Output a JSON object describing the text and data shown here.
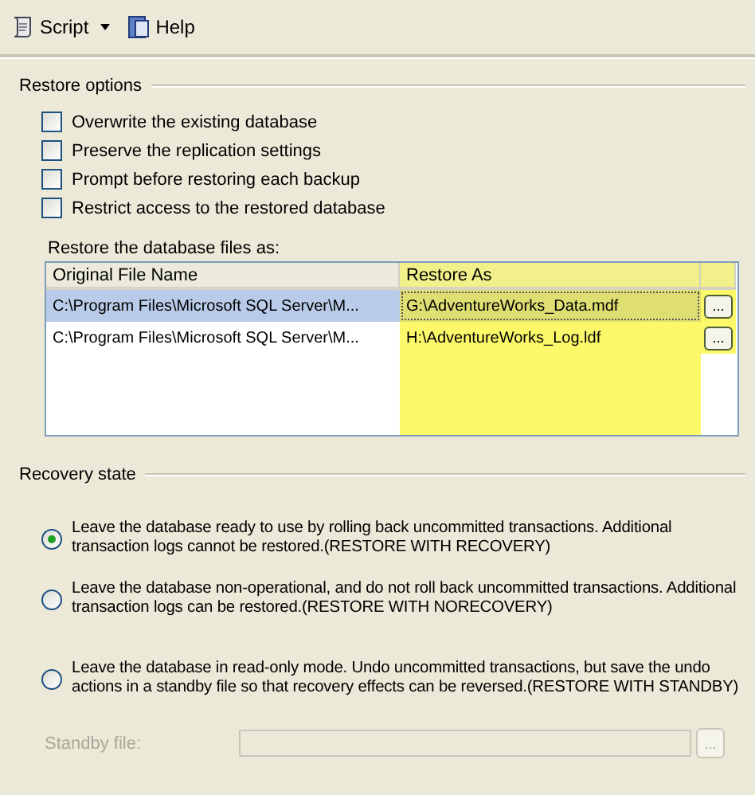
{
  "toolbar": [
    {
      "kind": "script",
      "label": "Script",
      "dropdown": true
    },
    {
      "kind": "help",
      "label": "Help",
      "dropdown": false
    }
  ],
  "restore_options": {
    "title": "Restore options",
    "checkboxes": [
      {
        "label": "Overwrite the existing database",
        "checked": false
      },
      {
        "label": "Preserve the replication settings",
        "checked": false
      },
      {
        "label": "Prompt before restoring each backup",
        "checked": false
      },
      {
        "label": "Restrict access to the restored database",
        "checked": false
      }
    ]
  },
  "files": {
    "label": "Restore the database files as:",
    "columns": [
      {
        "title": "Original File Name",
        "highlighted": false
      },
      {
        "title": "Restore As",
        "highlighted": true
      }
    ],
    "rows": [
      {
        "original": "C:\\Program Files\\Microsoft SQL Server\\M...",
        "restore_as": "G:\\AdventureWorks_Data.mdf",
        "browse": "...",
        "selected": true
      },
      {
        "original": "C:\\Program Files\\Microsoft SQL Server\\M...",
        "restore_as": "H:\\AdventureWorks_Log.ldf",
        "browse": "...",
        "selected": false
      }
    ]
  },
  "recovery_state": {
    "title": "Recovery state",
    "options": [
      {
        "label": "Leave the database ready to use by rolling back uncommitted transactions. Additional transaction logs cannot be restored.(RESTORE WITH RECOVERY)",
        "selected": true
      },
      {
        "label": "Leave the database non-operational, and do not roll back uncommitted transactions. Additional transaction logs can be restored.(RESTORE WITH NORECOVERY)",
        "selected": false
      },
      {
        "label": "Leave the database in read-only mode. Undo uncommitted transactions, but save the undo actions in a standby file so that recovery effects can be reversed.(RESTORE WITH STANDBY)",
        "selected": false
      }
    ],
    "standby": {
      "label": "Standby file:",
      "browse": "...",
      "disabled": true
    }
  }
}
